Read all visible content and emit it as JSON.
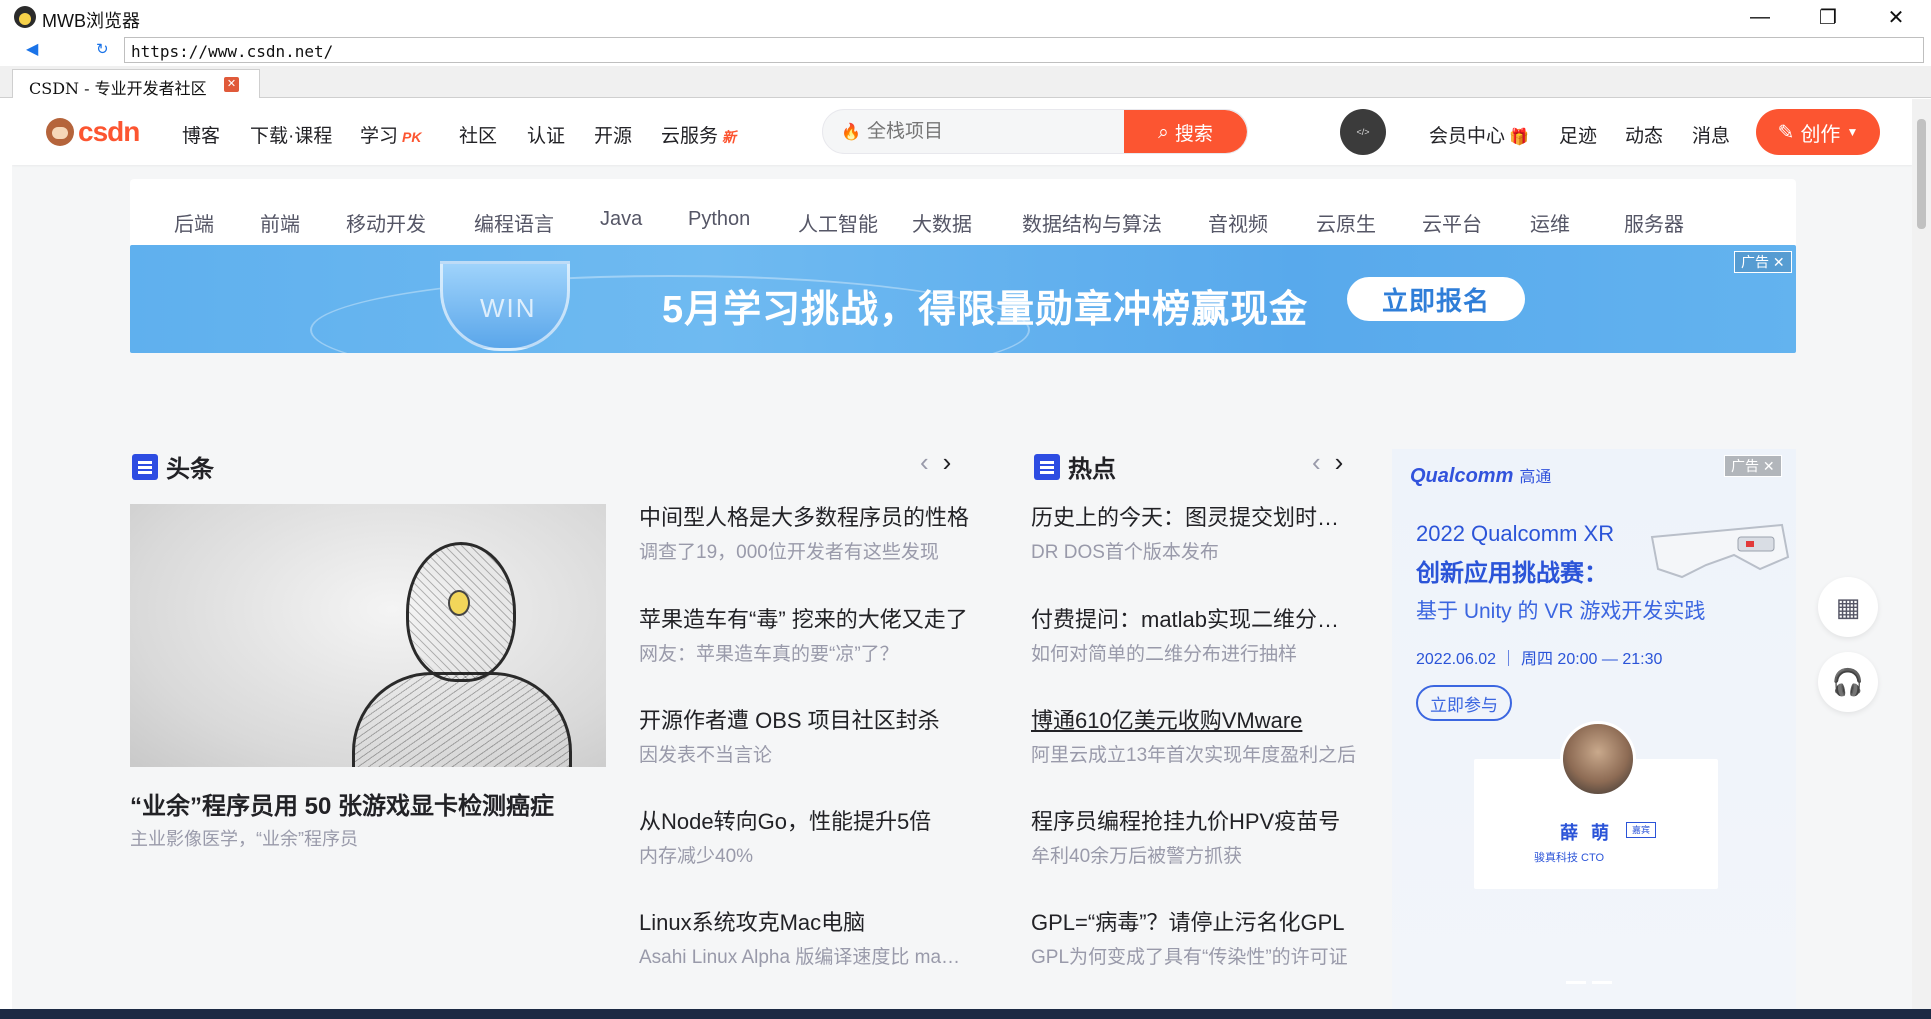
{
  "window": {
    "title": "MWB浏览器",
    "minimize_glyph": "—",
    "maximize_glyph": "❐",
    "close_glyph": "✕"
  },
  "address": {
    "url": "https://www.csdn.net/"
  },
  "tabs": [
    {
      "label": "CSDN - 专业开发者社区"
    }
  ],
  "topnav": {
    "logo_text": "CSDN",
    "items": [
      {
        "label": "博客"
      },
      {
        "label": "下载·课程"
      },
      {
        "label": "学习",
        "badge": "PK"
      },
      {
        "label": "社区"
      },
      {
        "label": "认证"
      },
      {
        "label": "开源"
      },
      {
        "label": "云服务",
        "badge": "新"
      }
    ],
    "search": {
      "placeholder": "全栈项目",
      "button_label": "搜索"
    },
    "right_items": [
      {
        "label": "会员中心"
      },
      {
        "label": "足迹"
      },
      {
        "label": "动态"
      },
      {
        "label": "消息"
      }
    ],
    "create_label": "创作"
  },
  "categories": [
    "后端",
    "前端",
    "移动开发",
    "编程语言",
    "Java",
    "Python",
    "人工智能",
    "大数据",
    "数据结构与算法",
    "音视频",
    "云原生",
    "云平台",
    "运维",
    "服务器"
  ],
  "banner": {
    "cup_text": "WIN",
    "headline": "5月学习挑战，得限量勋章冲榜赢现金",
    "cta_label": "立即报名",
    "ad_label": "广告 ✕"
  },
  "headlines": {
    "title": "头条",
    "feature": {
      "title": "“业余”程序员用 50 张游戏显卡检测癌症",
      "subtitle": "主业影像医学，“业余”程序员"
    },
    "items": [
      {
        "title": "中间型人格是大多数程序员的性格",
        "desc": "调查了19，000位开发者有这些发现"
      },
      {
        "title": "苹果造车有“毒” 挖来的大佬又走了",
        "desc": "网友：苹果造车真的要“凉”了？"
      },
      {
        "title": "开源作者遭 OBS 项目社区封杀",
        "desc": "因发表不当言论"
      },
      {
        "title": "从Node转向Go，性能提升5倍",
        "desc": "内存减少40%"
      },
      {
        "title": "Linux系统攻克Mac电脑",
        "desc": "Asahi Linux Alpha 版编译速度比 macOS 更快"
      }
    ]
  },
  "hot": {
    "title": "热点",
    "items": [
      {
        "title": "历史上的今天：图灵提交划时代论文",
        "desc": "DR DOS首个版本发布"
      },
      {
        "title": "付费提问：matlab实现二维分布抽样",
        "desc": "如何对简单的二维分布进行抽样"
      },
      {
        "title": "博通610亿美元收购VMware",
        "desc": "阿里云成立13年首次实现年度盈利之后"
      },
      {
        "title": "程序员编程抢挂九价HPV疫苗号",
        "desc": "牟利40余万后被警方抓获"
      },
      {
        "title": "GPL=“病毒”？请停止污名化GPL",
        "desc": "GPL为何变成了具有“传染性”的许可证"
      }
    ]
  },
  "side_ad": {
    "ad_label": "广告 ✕",
    "brand": "Qualcomm",
    "brand_cn": "高通",
    "line1": "2022 Qualcomm XR",
    "line2": "创新应用挑战赛：",
    "line3": "基于 Unity 的 VR 游戏开发实践",
    "date": "2022.06.02 ｜ 周四 20:00 — 21:30",
    "join_label": "立即参与",
    "speaker_name": "薛 萌",
    "speaker_tag": "嘉宾",
    "speaker_title": "骏真科技 CTO"
  },
  "colors": {
    "brand": "#fc5531",
    "section_icon": "#2d4ce2",
    "ad_blue": "#2b54d8"
  }
}
